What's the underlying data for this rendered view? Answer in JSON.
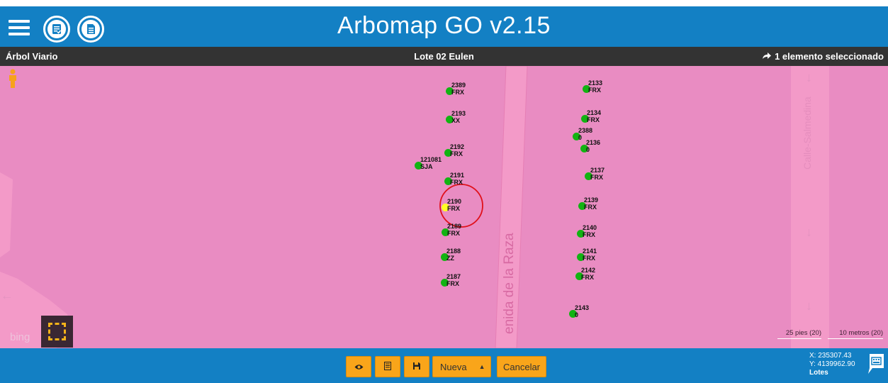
{
  "header": {
    "title": "Arbomap GO v2.15"
  },
  "subheader": {
    "left": "Árbol Viario",
    "center": "Lote 02 Eulen",
    "right": "1 elemento seleccionado"
  },
  "map": {
    "streets": [
      "enida de la Raza",
      "Calle-Salmedina"
    ],
    "provider": "bing",
    "scale_feet": "25 pies (20)",
    "scale_meters": "10 metros (20)",
    "trees": [
      {
        "id": "2389",
        "species": "FRX"
      },
      {
        "id": "2193",
        "species": "XX"
      },
      {
        "id": "2192",
        "species": "FRX"
      },
      {
        "id": "121081",
        "species": "SJA"
      },
      {
        "id": "2191",
        "species": "FRX"
      },
      {
        "id": "2190",
        "species": "FRX",
        "selected": true
      },
      {
        "id": "2189",
        "species": "FRX"
      },
      {
        "id": "2188",
        "species": "ZZ"
      },
      {
        "id": "2187",
        "species": "FRX"
      },
      {
        "id": "2133",
        "species": "FRX"
      },
      {
        "id": "2134",
        "species": "FRX"
      },
      {
        "id": "2388",
        "species": "0"
      },
      {
        "id": "2136",
        "species": "0"
      },
      {
        "id": "2137",
        "species": "FRX"
      },
      {
        "id": "2139",
        "species": "FRX"
      },
      {
        "id": "2140",
        "species": "FRX"
      },
      {
        "id": "2141",
        "species": "FRX"
      },
      {
        "id": "2142",
        "species": "FRX"
      },
      {
        "id": "2143",
        "species": "0"
      }
    ]
  },
  "footer": {
    "nueva_label": "Nueva",
    "cancelar_label": "Cancelar",
    "coord_x": "X: 235307.43",
    "coord_y": "Y: 4139962.90",
    "lotes_label": "Lotes"
  },
  "colors": {
    "header_bg": "#1380c4",
    "subheader_bg": "#333333",
    "map_bg": "#e98cc2",
    "road": "#f39ac8",
    "tree_dot": "#12b312",
    "selected_dot": "#ffff22",
    "selection_ring": "#e0101a",
    "button_bg": "#f9a51a"
  },
  "icons": {
    "menu": "hamburger-icon",
    "list": "list-check-icon",
    "document": "document-icon",
    "person": "person-icon",
    "select": "selection-tool-icon",
    "view": "eye-icon",
    "form": "form-icon",
    "save": "save-icon",
    "keyboard": "keyboard-icon",
    "arrow": "share-arrow-icon"
  }
}
